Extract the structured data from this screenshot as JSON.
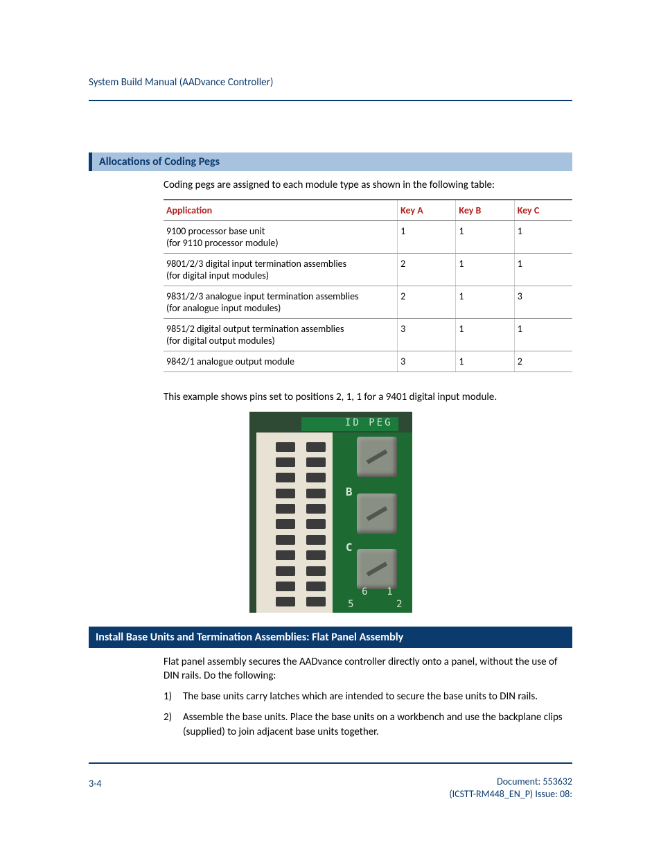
{
  "header": {
    "title": "System Build Manual  (AADvance Controller)"
  },
  "section1": {
    "heading": "Allocations of Coding Pegs",
    "intro": "Coding pegs are assigned to each module type as shown in the following table:"
  },
  "table": {
    "headers": {
      "application": "Application",
      "keyA": "Key A",
      "keyB": "Key B",
      "keyC": "Key C"
    },
    "rows": [
      {
        "app_l1": "9100 processor base unit",
        "app_l2": "(for 9110 processor module)",
        "a": "1",
        "b": "1",
        "c": "1"
      },
      {
        "app_l1": "9801/2/3 digital input termination assemblies",
        "app_l2": "(for digital input modules)",
        "a": "2",
        "b": "1",
        "c": "1"
      },
      {
        "app_l1": "9831/2/3 analogue input termination assemblies",
        "app_l2": "(for analogue input modules)",
        "a": "2",
        "b": "1",
        "c": "3"
      },
      {
        "app_l1": "9851/2 digital output termination assemblies",
        "app_l2": "(for digital output modules)",
        "a": "3",
        "b": "1",
        "c": "1"
      },
      {
        "app_l1": "9842/1 analogue output module",
        "app_l2": "",
        "a": "3",
        "b": "1",
        "c": "2"
      }
    ]
  },
  "example_text": "This example shows pins set to positions 2, 1, 1 for a 9401 digital input module.",
  "pcb": {
    "strip": "ID PEG",
    "B": "B",
    "C": "C",
    "n5": "5",
    "n6": "6",
    "n1": "1",
    "n2": "2"
  },
  "section2": {
    "heading": "Install Base Units and Termination Assemblies: Flat Panel Assembly",
    "intro": "Flat panel assembly secures the AADvance controller directly onto a panel, without the use of DIN rails. Do the following:",
    "steps": [
      "The base units carry latches which are intended to secure the base units to DIN rails.",
      "Assemble the base units. Place the base units on a workbench and use the backplane clips (supplied) to join adjacent base units together."
    ]
  },
  "footer": {
    "page": "3-4",
    "doc_line1": "Document: 553632",
    "doc_line2": "(ICSTT-RM448_EN_P) Issue: 08:"
  }
}
